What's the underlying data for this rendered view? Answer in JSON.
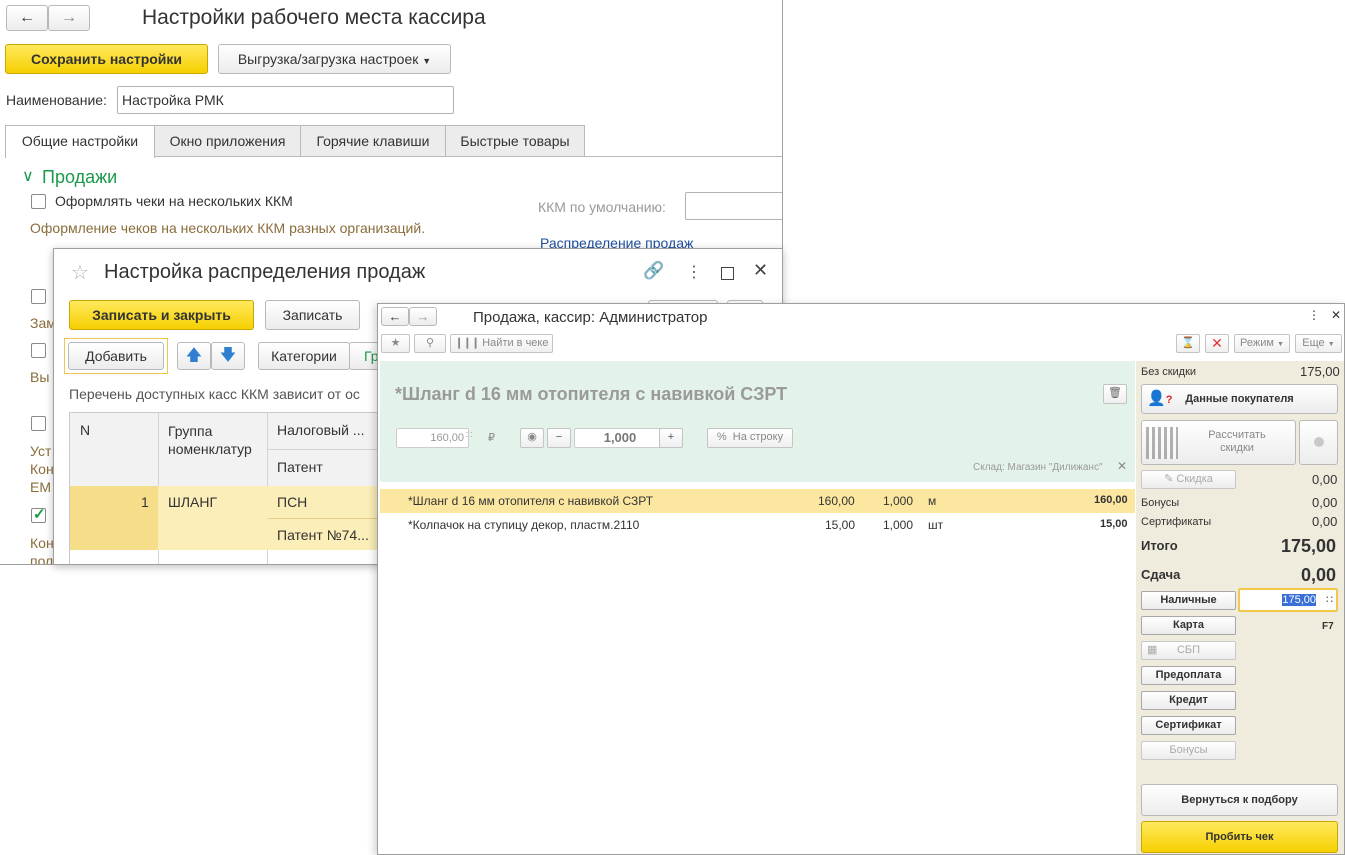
{
  "main": {
    "title": "Настройки рабочего места кассира",
    "save_label": "Сохранить настройки",
    "export_label": "Выгрузка/загрузка настроек",
    "name_label": "Наименование:",
    "name_value": "Настройка РМК",
    "tabs": [
      {
        "label": "Общие настройки"
      },
      {
        "label": "Окно приложения"
      },
      {
        "label": "Горячие клавиши"
      },
      {
        "label": "Быстрые товары"
      }
    ],
    "section_title": "Продажи",
    "checkbox_multi_kkm": "Оформлять чеки на нескольких ККМ",
    "hint_multi_kkm": "Оформление чеков на нескольких ККМ разных организаций.",
    "default_kkm_label": "ККМ по умолчанию:",
    "sales_distribution_link": "Распределение продаж",
    "left_fragments": [
      "Зам",
      "Вы",
      "Уст",
      "Кон",
      "ЕМ",
      "Кон",
      "пол"
    ]
  },
  "dialog": {
    "title": "Настройка распределения продаж",
    "save_close_label": "Записать и закрыть",
    "save_label": "Записать",
    "add_label": "Добавить",
    "categories_label": "Категории",
    "categories_next": "Гр",
    "hint": "Перечень доступных касс ККМ зависит от ос",
    "columns": {
      "n": "N",
      "group": "Группа номенклатур",
      "tax": "Налоговый ...",
      "patent": "Патент"
    },
    "rows": [
      {
        "n": "1",
        "group": "ШЛАНГ",
        "tax": "ПСН",
        "patent": "Патент №74..."
      }
    ]
  },
  "sale": {
    "title": "Продажа, кассир: Администратор",
    "find_label": "Найти в чеке",
    "mode_label": "Режим",
    "more_label": "Еще",
    "product_name": "*Шланг d 16 мм отопителя с навивкой СЗРТ",
    "price_value": "160,00",
    "currency": "₽",
    "qty_value": "1,000",
    "to_row_label": "На строку",
    "warehouse": "Склад: Магазин \"Дилижанс\"",
    "lines": [
      {
        "name": "*Шланг d 16 мм отопителя с навивкой СЗРТ",
        "price": "160,00",
        "qty": "1,000",
        "unit": "м",
        "sum": "160,00"
      },
      {
        "name": "*Колпачок на ступицу декор, пластм.2110",
        "price": "15,00",
        "qty": "1,000",
        "unit": "шт",
        "sum": "15,00"
      }
    ],
    "panel": {
      "no_discount_label": "Без скидки",
      "no_discount_value": "175,00",
      "buyer_label": "Данные покупателя",
      "calc_discount_label": "Рассчитать скидки",
      "discount_label": "Скидка",
      "discount_value": "0,00",
      "bonus_label": "Бонусы",
      "bonus_value": "0,00",
      "certs_label": "Сертификаты",
      "certs_value": "0,00",
      "total_label": "Итого",
      "total_value": "175,00",
      "change_label": "Сдача",
      "change_value": "0,00",
      "cash_label": "Наличные",
      "cash_value": "175,00",
      "card_label": "Карта",
      "card_hotkey": "F7",
      "sbp_label": "СБП",
      "prepay_label": "Предоплата",
      "credit_label": "Кредит",
      "cert_label": "Сертификат",
      "bonuses_label": "Бонусы",
      "back_label": "Вернуться к подбору",
      "print_label": "Пробить чек"
    }
  }
}
